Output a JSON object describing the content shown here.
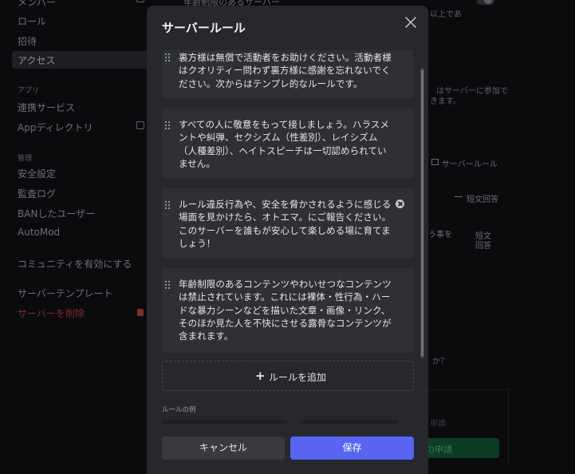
{
  "sidebar": {
    "items": [
      {
        "label": "メンバー"
      },
      {
        "label": "ロール"
      },
      {
        "label": "招待"
      },
      {
        "label": "アクセス"
      },
      {
        "label": "連携サービス"
      },
      {
        "label": "Appディレクトリ"
      },
      {
        "label": "安全設定"
      },
      {
        "label": "監査ログ"
      },
      {
        "label": "BANしたユーザー"
      },
      {
        "label": "AutoMod"
      },
      {
        "label": "コミュニティを有効にする"
      },
      {
        "label": "サーバーテンプレート"
      },
      {
        "label": "サーバーを削除"
      }
    ],
    "headings": {
      "apps": "アプリ",
      "moderation": "管理"
    }
  },
  "background": {
    "top_text": "年齢制限のあるサーバー",
    "top_right": "以上であ",
    "join_text_1": "はサーバーに参加で",
    "join_text_2": "きます。",
    "server_rules_tag": "サーバールール",
    "short_answer_1": "短文回答",
    "short_answer_2a": "短文",
    "short_answer_2b": "回答",
    "agree_fragment": "う事を",
    "question_fragment": "か？",
    "apply_fragment_1": "申請",
    "apply_button": "の申請"
  },
  "modal": {
    "title": "サーバールール",
    "rules": [
      {
        "text": "裏方様は無償で活動者をお助けください。活動者様はクオリティー問わず裏方様に感謝を忘れないでください。次からはテンプレ的なルールです。"
      },
      {
        "text": "すべての人に敬意をもって接しましょう。ハラスメントや糾弾、セクシズム（性差別）、レイシズム（人種差別）、ヘイトスピーチは一切認められていません。"
      },
      {
        "text": "ルール違反行為や、安全を脅かされるように感じる場面を見かけたら、オトエマ。にご報告ください。このサーバーを誰もが安心して楽しめる場に育てましょう！"
      },
      {
        "text": "年齢制限のあるコンテンツやわいせつなコンテンツは禁止されています。これには裸体・性行為・ハードな暴力シーンなどを描いた文章・画像・リンク、そのほか見た人を不快にさせる露骨なコンテンツが含まれます。"
      }
    ],
    "add_rule_label": "ルールを追加",
    "examples_label": "ルールの例",
    "cancel_label": "キャンセル",
    "save_label": "保存"
  },
  "colors": {
    "accent": "#5865f2",
    "modal_bg": "#27282d",
    "rule_bg": "#2e3036",
    "danger": "#da373c"
  }
}
